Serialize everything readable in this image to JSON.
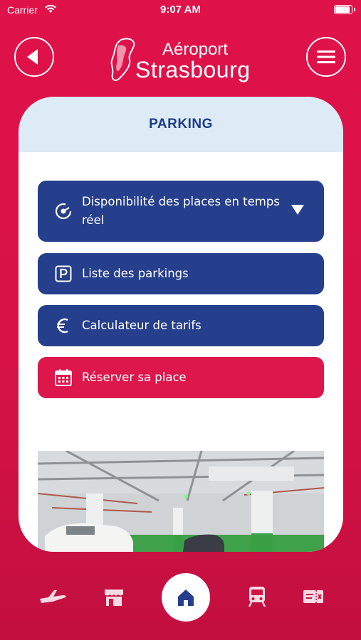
{
  "status_bar": {
    "carrier": "Carrier",
    "time": "9:07 AM"
  },
  "header": {
    "logo_line1": "Aéroport",
    "logo_line2": "Strasbourg",
    "back_icon": "back-arrow-icon",
    "menu_icon": "hamburger-menu-icon"
  },
  "card": {
    "title": "PARKING",
    "buttons": [
      {
        "label": "Disponibilité des places en temps réel",
        "icon": "gauge-icon",
        "style": "blue",
        "has_caret": true
      },
      {
        "label": "Liste des parkings",
        "icon": "parking-icon",
        "style": "blue"
      },
      {
        "label": "Calculateur de tarifs",
        "icon": "euro-icon",
        "style": "blue"
      },
      {
        "label": "Réserver sa place",
        "icon": "calendar-icon",
        "style": "red"
      }
    ]
  },
  "tabbar": {
    "items": [
      {
        "icon": "airplane-icon"
      },
      {
        "icon": "shop-icon"
      },
      {
        "icon": "home-icon",
        "active": true
      },
      {
        "icon": "train-icon"
      },
      {
        "icon": "ticket-icon"
      }
    ]
  },
  "colors": {
    "brand_red": "#dd174c",
    "brand_blue": "#263f8c",
    "card_header": "#dcebf6",
    "title_blue": "#1c3c8a"
  }
}
